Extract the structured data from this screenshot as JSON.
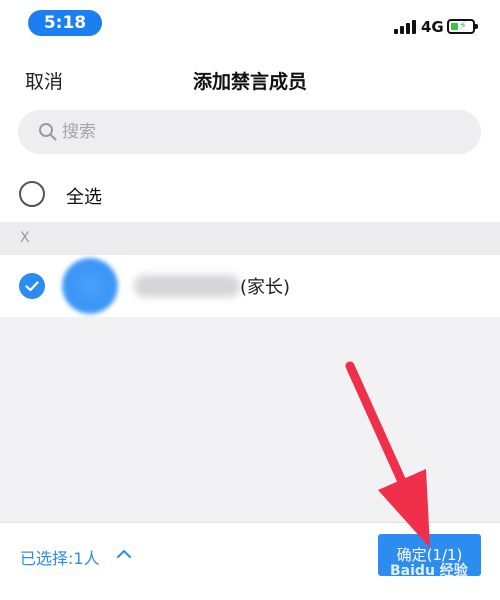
{
  "status_bar": {
    "time": "5:18",
    "network": "4G"
  },
  "nav": {
    "cancel_label": "取消",
    "title": "添加禁言成员"
  },
  "search": {
    "placeholder": "搜索"
  },
  "select_all": {
    "label": "全选"
  },
  "members": {
    "section_letter": "X",
    "items": [
      {
        "role": "(家长)",
        "checked": true
      }
    ]
  },
  "bottom_bar": {
    "selected_text": "已选择:1人",
    "confirm_label": "确定(1/1)"
  },
  "colors": {
    "accent": "#2d8cf0",
    "time_pill": "#1a7ff0",
    "annotation_arrow": "#f0304a"
  },
  "watermark": "Baidu 经验"
}
